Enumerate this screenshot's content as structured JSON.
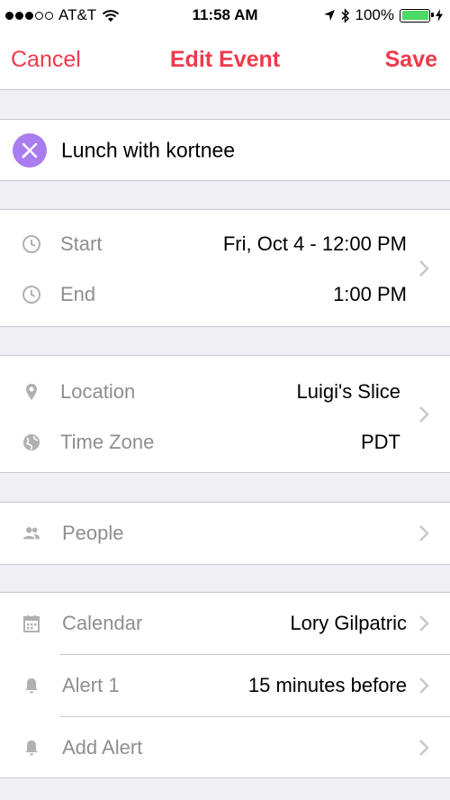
{
  "status": {
    "carrier": "AT&T",
    "time": "11:58 AM",
    "battery": "100%"
  },
  "nav": {
    "cancel": "Cancel",
    "title": "Edit Event",
    "save": "Save"
  },
  "event": {
    "title": "Lunch with kortnee"
  },
  "time_section": {
    "start_label": "Start",
    "start_value": "Fri, Oct 4 - 12:00 PM",
    "end_label": "End",
    "end_value": "1:00 PM"
  },
  "place_section": {
    "location_label": "Location",
    "location_value": "Luigi's Slice",
    "timezone_label": "Time Zone",
    "timezone_value": "PDT"
  },
  "people": {
    "label": "People"
  },
  "settings": {
    "calendar_label": "Calendar",
    "calendar_value": "Lory Gilpatric",
    "alert1_label": "Alert 1",
    "alert1_value": "15 minutes before",
    "add_alert_label": "Add Alert"
  },
  "colors": {
    "accent": "#ee3a4c",
    "avatar": "#a97cef",
    "battery": "#4cd964"
  }
}
